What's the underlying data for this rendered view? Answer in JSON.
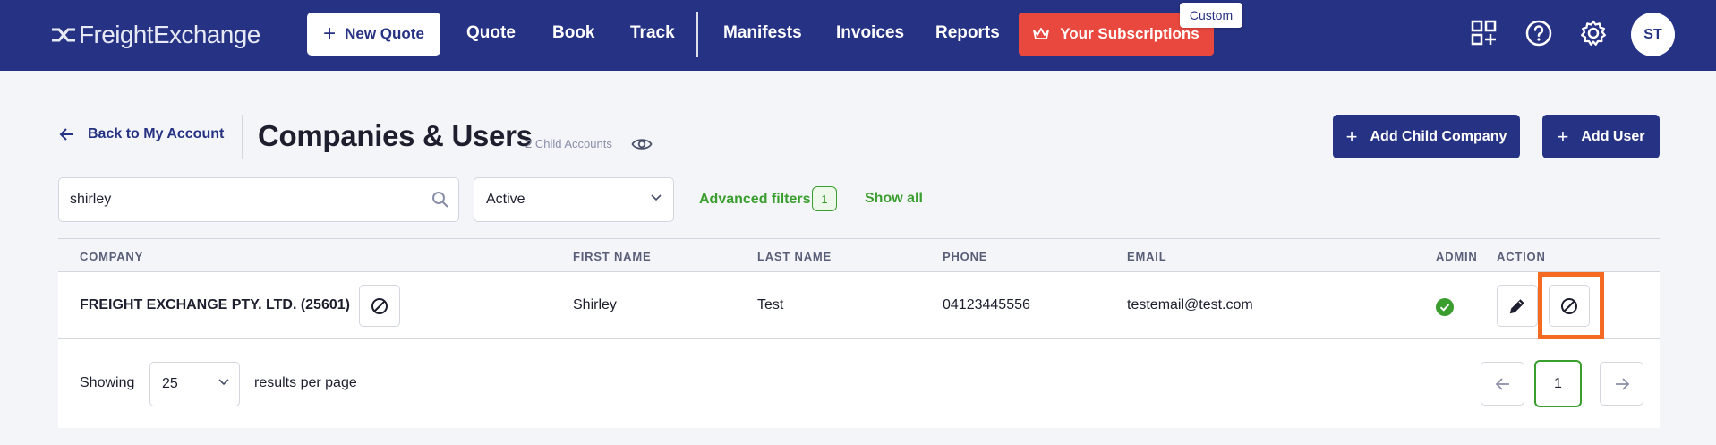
{
  "brand": {
    "name": "FreightExchange"
  },
  "nav": {
    "new_quote": "New Quote",
    "quote": "Quote",
    "book": "Book",
    "track": "Track",
    "manifests": "Manifests",
    "invoices": "Invoices",
    "reports": "Reports",
    "subscriptions": "Your Subscriptions",
    "custom_badge": "Custom",
    "avatar_initials": "ST"
  },
  "header": {
    "back_label": "Back to My Account",
    "title": "Companies & Users",
    "child_accounts": "2 Child Accounts",
    "add_child_company": "Add Child Company",
    "add_user": "Add User"
  },
  "filters": {
    "search_value": "shirley",
    "status_value": "Active",
    "advanced_filters_label": "Advanced filters",
    "advanced_filters_count": "1",
    "show_all_label": "Show all"
  },
  "table": {
    "columns": {
      "company": "COMPANY",
      "first_name": "FIRST NAME",
      "last_name": "LAST NAME",
      "phone": "PHONE",
      "email": "EMAIL",
      "admin": "ADMIN",
      "action": "ACTION"
    },
    "rows": [
      {
        "company": "FREIGHT EXCHANGE PTY. LTD. (25601)",
        "first_name": "Shirley",
        "last_name": "Test",
        "phone": "04123445556",
        "email": "testemail@test.com",
        "admin": true
      }
    ]
  },
  "pagination": {
    "showing_label": "Showing",
    "per_page_value": "25",
    "results_label": "results per page",
    "current_page": "1"
  },
  "colors": {
    "nav_bg": "#263283",
    "subscriptions_bg": "#e9483f",
    "accent_green": "#3a9e2e",
    "highlight_orange": "#f56a22"
  }
}
